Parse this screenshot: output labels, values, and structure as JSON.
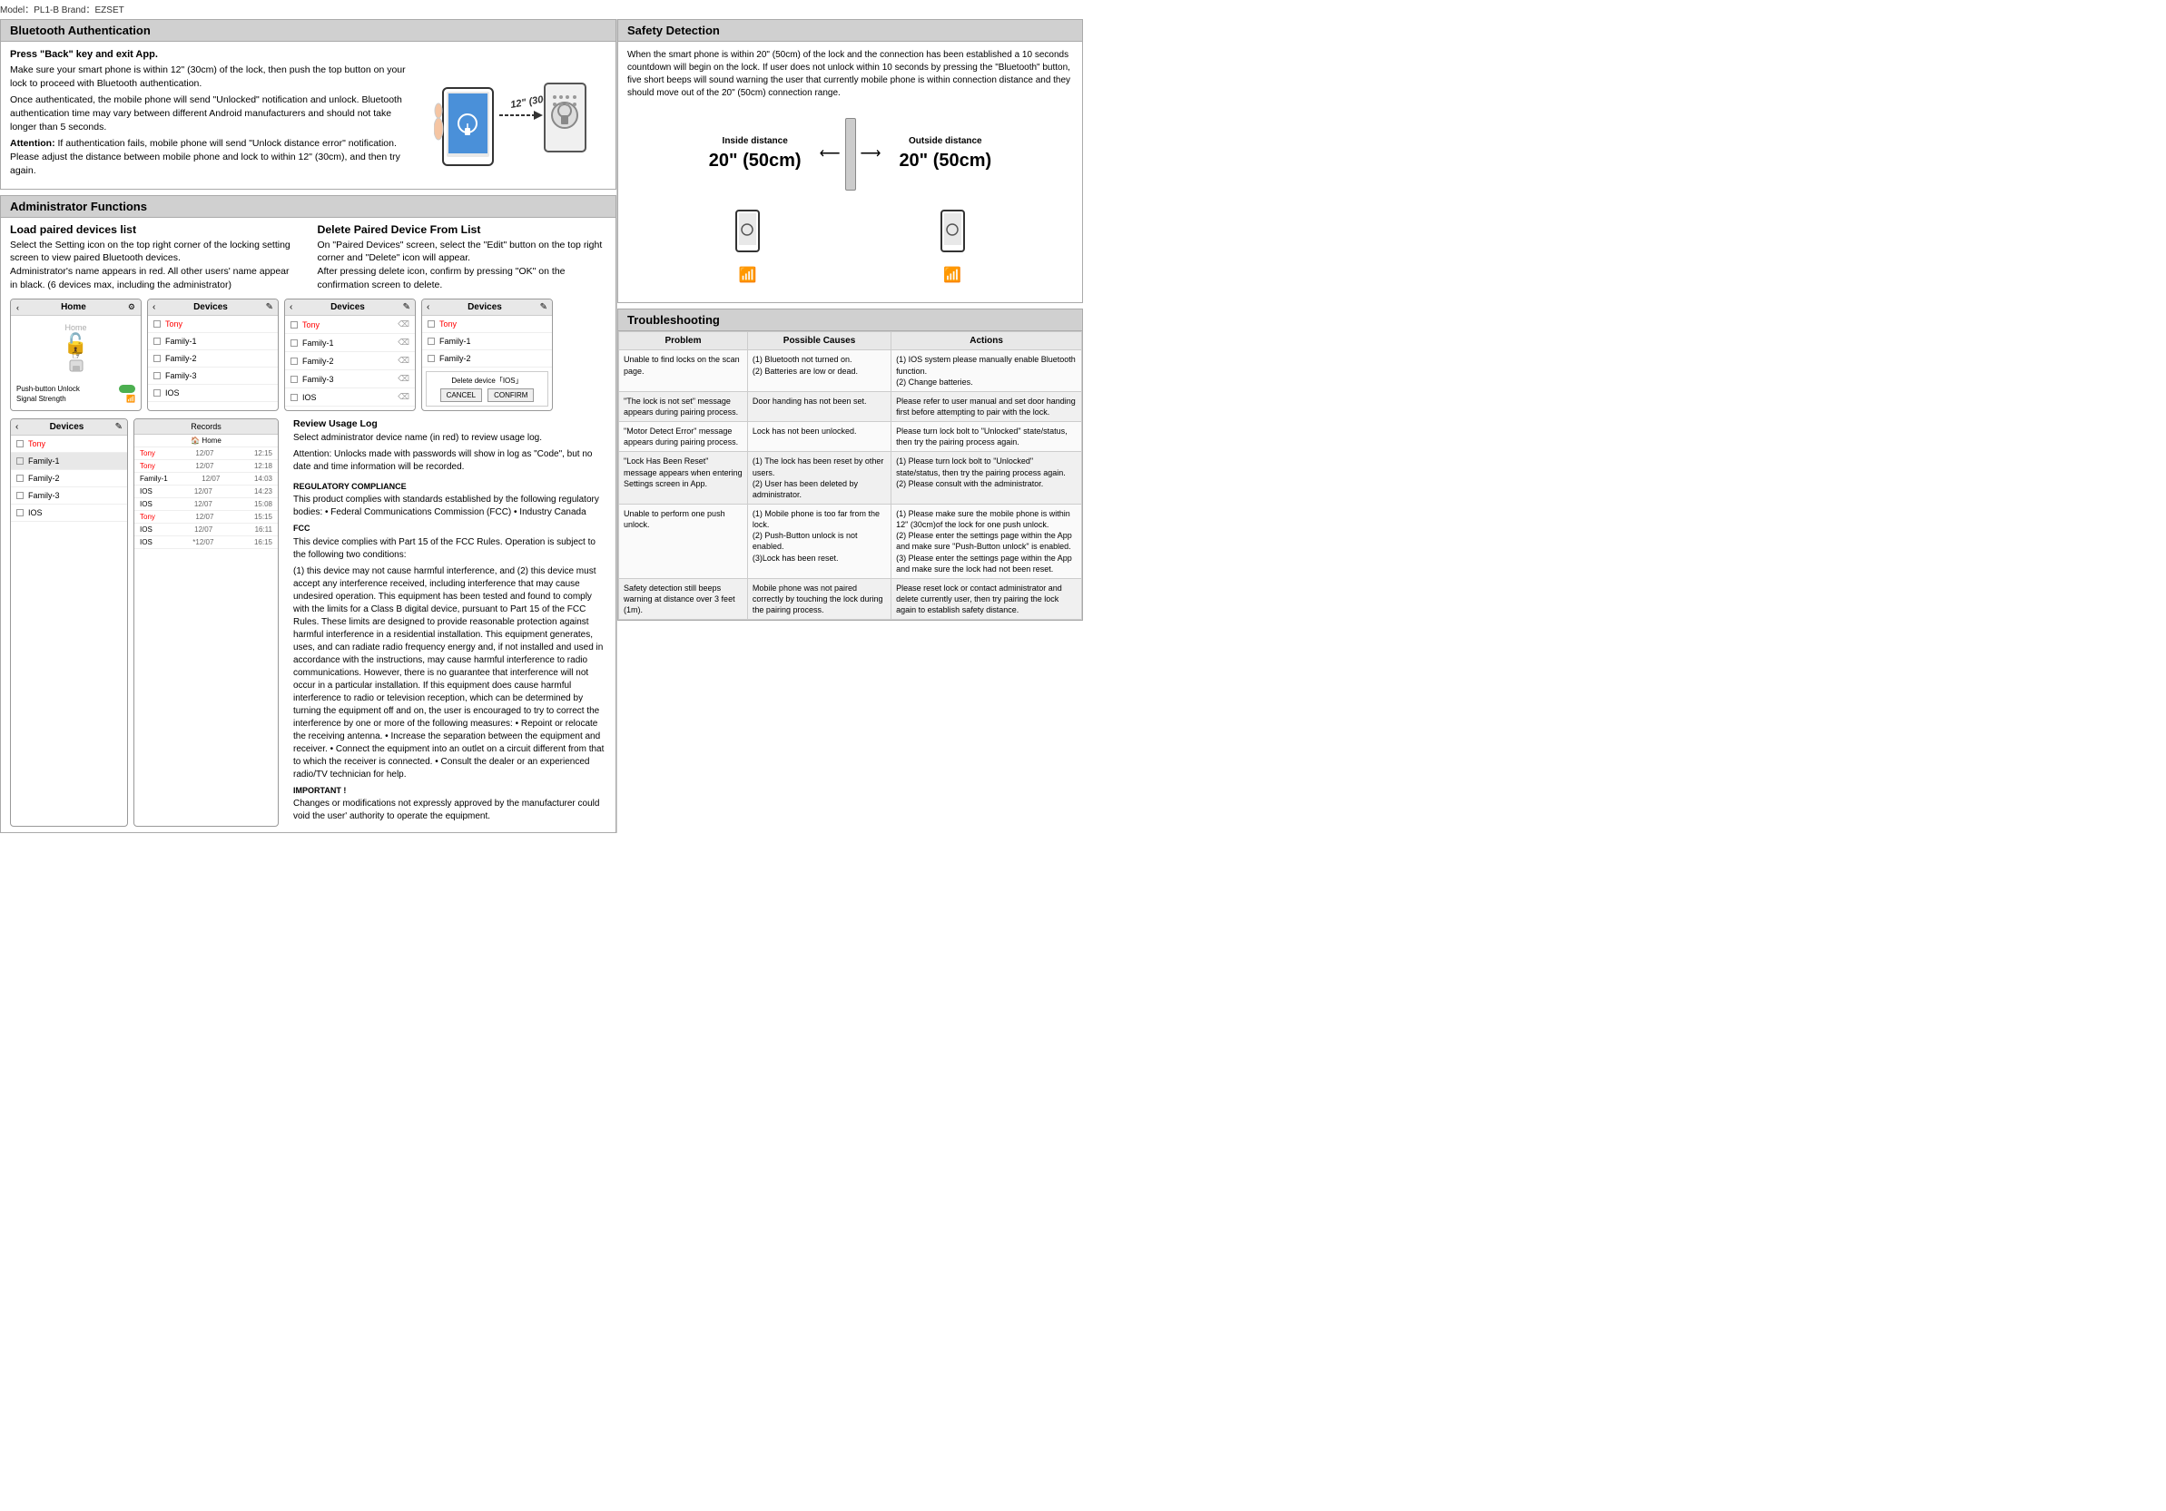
{
  "meta": {
    "model": "Model：PL1-B   Brand：EZSET"
  },
  "bluetooth_auth": {
    "section_title": "Bluetooth Authentication",
    "step_title": "Press \"Back\" key and exit App.",
    "step_description1": "Make sure your smart phone is within 12\" (30cm) of the lock, then push the top button on your lock to proceed with Bluetooth authentication.",
    "step_description2": "Once authenticated, the mobile phone will send \"Unlocked\" notification and unlock. Bluetooth authentication time may vary between different Android manufacturers and should not take longer than 5 seconds.",
    "attention_label": "Attention:",
    "attention_text": "If authentication fails, mobile phone will send \"Unlock distance error\" notification. Please adjust the distance between mobile phone and lock to within 12\" (30cm), and then try again.",
    "distance_label": "12\" (30cm)"
  },
  "admin_functions": {
    "section_title": "Administrator Functions",
    "load_title": "Load paired devices list",
    "load_desc1": "Select the Setting icon on the top right corner of the locking setting screen to view paired Bluetooth devices.",
    "load_desc2": "Administrator's name appears in red. All other users' name appear in black. (6 devices max, including the administrator)",
    "delete_title": "Delete Paired Device From List",
    "delete_desc1": "On \"Paired Devices\" screen, select the \"Edit\" button on the top right corner and \"Delete\" icon will appear.",
    "delete_desc2": "After pressing delete icon, confirm by pressing \"OK\" on the confirmation screen to delete.",
    "review_title": "Review Usage Log",
    "review_desc1": "Select administrator device name (in red) to review usage log.",
    "review_desc2": "Attention: Unlocks made with passwords will show in log as \"Code\", but no date and time information will be recorded.",
    "screens": {
      "home": {
        "title": "Home",
        "items": [
          "Home"
        ],
        "push_button": "Push-button Unlock",
        "signal": "Signal Strength"
      },
      "devices1": {
        "title": "Devices",
        "items": [
          "Tony",
          "Family-1",
          "Family-2",
          "Family-3",
          "IOS"
        ]
      },
      "devices2": {
        "title": "Devices",
        "items": [
          "Tony",
          "Family-1",
          "Family-2",
          "Family-3",
          "IOS"
        ]
      },
      "devices3": {
        "title": "Devices",
        "items": [
          "Tony",
          "Family-1",
          "Family-2"
        ],
        "dialog_text": "Delete device「IOS」",
        "cancel": "CANCEL",
        "confirm": "CONFIRM"
      }
    },
    "bottom_screens": {
      "devices_bottom": {
        "title": "Devices",
        "items": [
          "Tony",
          "Family-1",
          "Family-2",
          "Family-3",
          "IOS"
        ]
      },
      "records": {
        "title": "Records",
        "subtitle": "Home",
        "rows": [
          {
            "name": "Tony",
            "date": "12/07",
            "time": "12:15"
          },
          {
            "name": "Tony",
            "date": "12/07",
            "time": "12:18"
          },
          {
            "name": "Family-1",
            "date": "12/07",
            "time": "14:03"
          },
          {
            "name": "IOS",
            "date": "12/07",
            "time": "14:23"
          },
          {
            "name": "IOS",
            "date": "12/07",
            "time": "15:08"
          },
          {
            "name": "Tony",
            "date": "12/07",
            "time": "15:15"
          },
          {
            "name": "IOS",
            "date": "12/07",
            "time": "16:11"
          },
          {
            "name": "IOS",
            "date": "*12/07",
            "time": "16:15"
          }
        ]
      }
    }
  },
  "regulatory": {
    "compliance_title": "REGULATORY COMPLIANCE",
    "compliance_text": "This product complies with standards established by the following regulatory bodies: • Federal Communications Commission (FCC) • Industry Canada",
    "fcc_title": "FCC",
    "fcc_desc": "This device complies with Part 15 of the FCC Rules. Operation is subject to the following two conditions:",
    "fcc_conditions": "(1) this device may not cause harmful interference, and (2) this device must accept any interference received, including interference that may cause undesired operation. This equipment has been tested and found to comply with the limits for a Class B digital device, pursuant to Part 15 of the FCC Rules. These limits are designed to provide reasonable protection against harmful interference in a residential installation. This equipment generates, uses, and can radiate radio frequency energy and, if not installed and used in accordance with the instructions, may cause harmful interference to radio communications. However, there is no guarantee that interference will not occur in a particular installation. If this equipment does cause harmful interference to radio or television reception, which can be determined by turning the equipment off and on, the user is encouraged to try to correct the interference by one or more of the following measures: • Repoint or relocate the receiving antenna. • Increase the separation between the equipment and receiver. • Connect the equipment into an outlet on a circuit different from that to which the receiver is connected. • Consult the dealer or an experienced radio/TV technician for help.",
    "important_title": "IMPORTANT !",
    "important_text": "Changes or modifications not expressly approved by the manufacturer could void the user' authority to operate the equipment."
  },
  "safety": {
    "section_title": "Safety Detection",
    "description": "When the smart phone is within 20\" (50cm) of the lock and the connection has been established a 10 seconds countdown will begin on the lock. If user does not unlock within 10 seconds by pressing the \"Bluetooth\" button, five short beeps will sound warning the user that currently mobile phone is within connection distance and they should move out of the 20\" (50cm) connection range.",
    "inside_label": "Inside distance",
    "inside_value": "20\" (50cm)",
    "outside_label": "Outside distance",
    "outside_value": "20\" (50cm)"
  },
  "troubleshooting": {
    "section_title": "Troubleshooting",
    "columns": [
      "Problem",
      "Possible Causes",
      "Actions"
    ],
    "rows": [
      {
        "problem": "Unable to find locks on the scan page.",
        "causes": "(1) Bluetooth not turned on.\n(2) Batteries are low or dead.",
        "actions": "(1) IOS system please manually enable Bluetooth function.\n(2) Change batteries."
      },
      {
        "problem": "\"The lock is not set\" message appears during pairing process.",
        "causes": "Door handing has not been set.",
        "actions": "Please refer to user manual and set door handing first before attempting to pair with the lock."
      },
      {
        "problem": "\"Motor Detect Error\" message appears during pairing process.",
        "causes": "Lock has not been unlocked.",
        "actions": "Please turn lock bolt to \"Unlocked\" state/status, then try the pairing process again."
      },
      {
        "problem": "\"Lock Has Been Reset\" message appears when entering Settings screen in App.",
        "causes": "(1) The lock has been reset by other users.\n(2) User has been deleted by administrator.",
        "actions": "(1) Please turn lock bolt to \"Unlocked\" state/status, then try the pairing process again.\n(2) Please consult with the administrator."
      },
      {
        "problem": "Unable to perform one push unlock.",
        "causes": "(1) Mobile phone is too far from the lock.\n(2) Push-Button unlock is not enabled.\n(3)Lock has been reset.",
        "actions": "(1) Please make sure the mobile phone is within 12\" (30cm)of the lock for one push unlock.\n(2) Please enter the settings page within the App and make sure \"Push-Button unlock\" is enabled.\n(3) Please enter the settings page within the App and make sure the lock had not been reset."
      },
      {
        "problem": "Safety detection still beeps warning at distance over 3 feet (1m).",
        "causes": "Mobile phone was not paired correctly by touching the lock during the pairing process.",
        "actions": "Please reset lock or contact administrator and delete currently user, then try pairing the lock again to establish safety distance."
      }
    ]
  }
}
